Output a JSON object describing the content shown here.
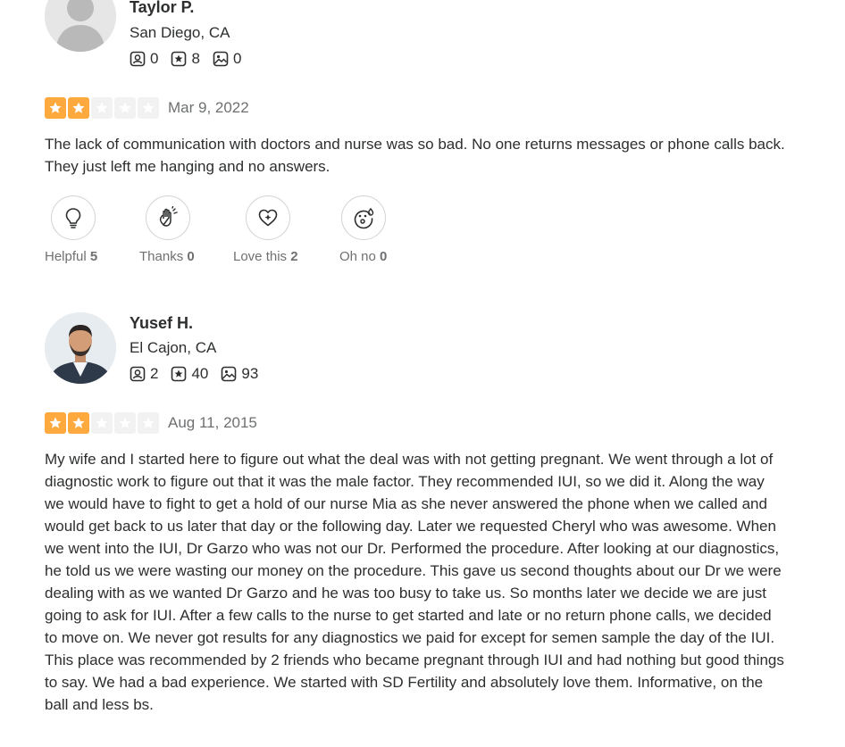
{
  "reviews": [
    {
      "name": "Taylor P.",
      "location": "San Diego, CA",
      "stats": {
        "friends": "0",
        "reviews": "8",
        "photos": "0"
      },
      "rating": 2,
      "max_rating": 5,
      "date": "Mar 9, 2022",
      "text": "The lack of communication with doctors and nurse was so bad. No one returns messages or phone calls back. They just left me hanging and no answers.",
      "reactions": [
        {
          "label": "Helpful",
          "count": "5",
          "icon": "lightbulb-icon"
        },
        {
          "label": "Thanks",
          "count": "0",
          "icon": "waving-hand-icon"
        },
        {
          "label": "Love this",
          "count": "2",
          "icon": "heart-icon"
        },
        {
          "label": "Oh no",
          "count": "0",
          "icon": "sad-face-icon"
        }
      ]
    },
    {
      "name": "Yusef H.",
      "location": "El Cajon, CA",
      "stats": {
        "friends": "2",
        "reviews": "40",
        "photos": "93"
      },
      "rating": 2,
      "max_rating": 5,
      "date": "Aug 11, 2015",
      "text": "My wife and I started here to figure out what the deal was with not getting pregnant. We went through a lot of diagnostic work to figure out that it was the male factor. They recommended IUI, so we did it. Along the way we would have to fight to get a hold of our nurse Mia as she never answered the phone when we called and would get back to us later that day or the following day. Later we requested Cheryl who was awesome. When we went into the IUI, Dr Garzo who was not our Dr. Performed the procedure. After looking at our diagnostics, he told us we were wasting our money on the procedure. This gave us second thoughts about our Dr we were dealing with as we wanted Dr Garzo and he was too busy to take us. So months later we decide we are just going to ask for IUI. After a few calls to the nurse to get started and late or no return phone calls, we decided to move on. We never got results for any diagnostics we paid for except for semen sample the day of the IUI. This place was recommended by 2 friends who became pregnant through IUI and had nothing but good things to say. We had a bad experience. We started with SD Fertility and absolutely love them. Informative, on the ball and less bs."
    }
  ],
  "colors": {
    "star_on": "#fea93e",
    "star_off": "#f2f2f2",
    "text": "#2d2e2f",
    "muted": "#6e7072"
  }
}
